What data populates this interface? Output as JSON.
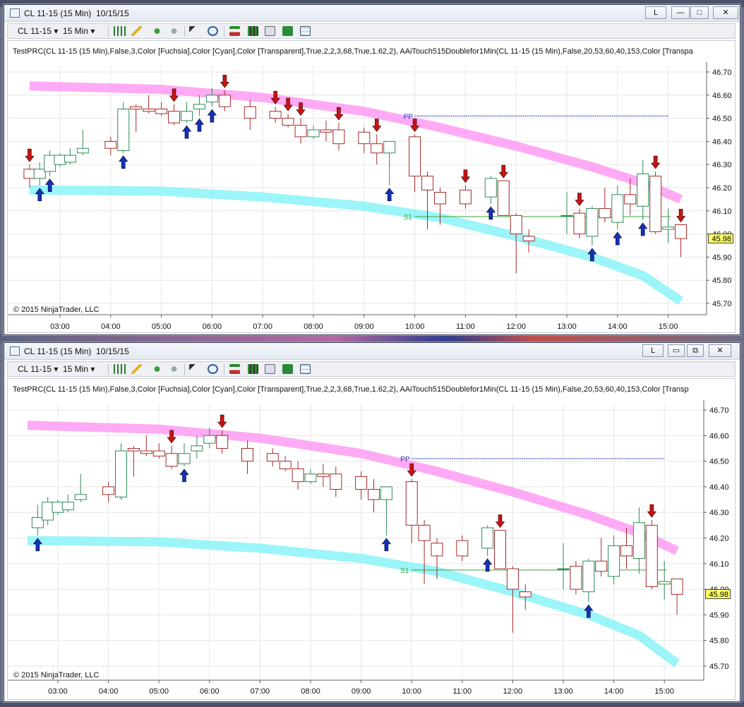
{
  "windows": [
    {
      "title": "CL 11-15 (15 Min)  10/15/15",
      "controls": {
        "link": "L",
        "minimize": "—",
        "maximize": "□",
        "close": "✕"
      },
      "toolbar": {
        "instrument": "CL 11-15",
        "interval": "15 Min"
      },
      "indicator_label": "TestPRC(CL 11-15 (15 Min),False,3,Color [Fuchsia],Color [Cyan],Color [Transparent],True,2,2,3,68,True,1.62,2), AAiTouch515Doublefor1Min(CL 11-15 (15 Min),False,20,53,60,40,153,Color [Transpa",
      "copyright": "© 2015 NinjaTrader, LLC",
      "last_price": "45.98",
      "pivot_labels": {
        "pp": "PP",
        "s1": "S1"
      }
    },
    {
      "title": "CL 11-15 (15 Min)  10/15/15",
      "controls": {
        "link": "L",
        "minimize": "▭",
        "maximize": "⧉",
        "close": "✕"
      },
      "toolbar": {
        "instrument": "CL 11-15",
        "interval": "15 Min"
      },
      "indicator_label": "TestPRC(CL 11-15 (15 Min),False,3,Color [Fuchsia],Color [Cyan],Color [Transparent],True,2,2,3,68,True,1.62,2), AAiTouch515Doublefor1Min(CL 11-15 (15 Min),False,20,53,60,40,153,Color [Transp",
      "copyright": "© 2015 NinjaTrader, LLC",
      "last_price": "45.98",
      "pivot_labels": {
        "pp": "PP",
        "s1": "S1"
      }
    }
  ],
  "chart_data": [
    {
      "type": "candlestick",
      "instrument": "CL 11-15",
      "interval": "15 Min",
      "x_ticks": [
        "03:00",
        "04:00",
        "05:00",
        "06:00",
        "07:00",
        "08:00",
        "09:00",
        "10:00",
        "11:00",
        "12:00",
        "13:00",
        "14:00",
        "15:00"
      ],
      "y_ticks": [
        "46.70",
        "46.60",
        "46.50",
        "46.40",
        "46.30",
        "46.20",
        "46.10",
        "46.00",
        "45.90",
        "45.80",
        "45.70"
      ],
      "ylim": [
        45.66,
        46.75
      ],
      "pivot_pp": 46.51,
      "pivot_s1": 46.075,
      "last_price": 45.98,
      "colors": {
        "up": "#2e8b57",
        "down": "#a52a2a",
        "upper_band": "#ff9bf2",
        "lower_band": "#8af3f8",
        "pivot_pp": "#1f2fb4",
        "pivot_s1": "#3aa53a",
        "sell_arrow": "#c41414",
        "buy_arrow": "#1432b4"
      },
      "candles": [
        {
          "t": 2.4,
          "o": 46.28,
          "h": 46.3,
          "l": 46.2,
          "c": 46.24
        },
        {
          "t": 2.6,
          "o": 46.24,
          "h": 46.31,
          "l": 46.21,
          "c": 46.28
        },
        {
          "t": 2.8,
          "o": 46.27,
          "h": 46.36,
          "l": 46.25,
          "c": 46.34
        },
        {
          "t": 3.0,
          "o": 46.3,
          "h": 46.35,
          "l": 46.29,
          "c": 46.34
        },
        {
          "t": 3.2,
          "o": 46.31,
          "h": 46.37,
          "l": 46.3,
          "c": 46.34
        },
        {
          "t": 3.45,
          "o": 46.35,
          "h": 46.45,
          "l": 46.34,
          "c": 46.37
        },
        {
          "t": 4.0,
          "o": 46.4,
          "h": 46.42,
          "l": 46.34,
          "c": 46.37
        },
        {
          "t": 4.25,
          "o": 46.36,
          "h": 46.57,
          "l": 46.35,
          "c": 46.54
        },
        {
          "t": 4.5,
          "o": 46.55,
          "h": 46.56,
          "l": 46.44,
          "c": 46.54
        },
        {
          "t": 4.75,
          "o": 46.54,
          "h": 46.6,
          "l": 46.52,
          "c": 46.53
        },
        {
          "t": 5.0,
          "o": 46.54,
          "h": 46.57,
          "l": 46.51,
          "c": 46.52
        },
        {
          "t": 5.25,
          "o": 46.53,
          "h": 46.56,
          "l": 46.47,
          "c": 46.48
        },
        {
          "t": 5.5,
          "o": 46.49,
          "h": 46.57,
          "l": 46.48,
          "c": 46.53
        },
        {
          "t": 5.75,
          "o": 46.54,
          "h": 46.6,
          "l": 46.51,
          "c": 46.56
        },
        {
          "t": 6.0,
          "o": 46.57,
          "h": 46.63,
          "l": 46.55,
          "c": 46.6
        },
        {
          "t": 6.25,
          "o": 46.6,
          "h": 46.62,
          "l": 46.53,
          "c": 46.55
        },
        {
          "t": 6.75,
          "o": 46.55,
          "h": 46.58,
          "l": 46.45,
          "c": 46.5
        },
        {
          "t": 7.25,
          "o": 46.53,
          "h": 46.55,
          "l": 46.48,
          "c": 46.5
        },
        {
          "t": 7.5,
          "o": 46.5,
          "h": 46.52,
          "l": 46.46,
          "c": 46.47
        },
        {
          "t": 7.75,
          "o": 46.47,
          "h": 46.5,
          "l": 46.39,
          "c": 46.42
        },
        {
          "t": 8.0,
          "o": 46.42,
          "h": 46.47,
          "l": 46.41,
          "c": 46.45
        },
        {
          "t": 8.25,
          "o": 46.45,
          "h": 46.49,
          "l": 46.4,
          "c": 46.44
        },
        {
          "t": 8.5,
          "o": 46.45,
          "h": 46.48,
          "l": 46.36,
          "c": 46.39
        },
        {
          "t": 9.0,
          "o": 46.44,
          "h": 46.46,
          "l": 46.35,
          "c": 46.39
        },
        {
          "t": 9.25,
          "o": 46.39,
          "h": 46.43,
          "l": 46.3,
          "c": 46.35
        },
        {
          "t": 9.5,
          "o": 46.35,
          "h": 46.4,
          "l": 46.21,
          "c": 46.4
        },
        {
          "t": 10.0,
          "o": 46.42,
          "h": 46.43,
          "l": 46.18,
          "c": 46.25
        },
        {
          "t": 10.25,
          "o": 46.25,
          "h": 46.27,
          "l": 46.02,
          "c": 46.19
        },
        {
          "t": 10.5,
          "o": 46.18,
          "h": 46.2,
          "l": 46.04,
          "c": 46.13
        },
        {
          "t": 11.0,
          "o": 46.19,
          "h": 46.21,
          "l": 46.11,
          "c": 46.13
        },
        {
          "t": 11.5,
          "o": 46.16,
          "h": 46.25,
          "l": 46.13,
          "c": 46.24
        },
        {
          "t": 11.75,
          "o": 46.23,
          "h": 46.23,
          "l": 46.08,
          "c": 46.08
        },
        {
          "t": 12.0,
          "o": 46.08,
          "h": 46.09,
          "l": 45.83,
          "c": 46.0
        },
        {
          "t": 12.25,
          "o": 45.99,
          "h": 46.02,
          "l": 45.92,
          "c": 45.97
        },
        {
          "t": 13.0,
          "o": 46.08,
          "h": 46.18,
          "l": 46.0,
          "c": 46.08
        },
        {
          "t": 13.25,
          "o": 46.09,
          "h": 46.11,
          "l": 45.98,
          "c": 46.0
        },
        {
          "t": 13.5,
          "o": 45.99,
          "h": 46.12,
          "l": 45.95,
          "c": 46.11
        },
        {
          "t": 13.75,
          "o": 46.11,
          "h": 46.2,
          "l": 46.05,
          "c": 46.07
        },
        {
          "t": 14.0,
          "o": 46.05,
          "h": 46.21,
          "l": 46.02,
          "c": 46.17
        },
        {
          "t": 14.25,
          "o": 46.17,
          "h": 46.24,
          "l": 46.08,
          "c": 46.13
        },
        {
          "t": 14.5,
          "o": 46.12,
          "h": 46.32,
          "l": 46.06,
          "c": 46.26
        },
        {
          "t": 14.75,
          "o": 46.25,
          "h": 46.27,
          "l": 46.0,
          "c": 46.01
        },
        {
          "t": 15.0,
          "o": 46.02,
          "h": 46.11,
          "l": 45.96,
          "c": 46.03
        },
        {
          "t": 15.25,
          "o": 46.04,
          "h": 46.04,
          "l": 45.9,
          "c": 45.98
        }
      ],
      "upper_band": [
        [
          2.4,
          46.64
        ],
        [
          5.0,
          46.625
        ],
        [
          7.0,
          46.59
        ],
        [
          9.0,
          46.53
        ],
        [
          10.5,
          46.46
        ],
        [
          12.0,
          46.38
        ],
        [
          13.5,
          46.29
        ],
        [
          14.5,
          46.22
        ],
        [
          15.25,
          46.15
        ]
      ],
      "lower_band": [
        [
          2.4,
          46.19
        ],
        [
          5.0,
          46.185
        ],
        [
          7.0,
          46.16
        ],
        [
          9.0,
          46.12
        ],
        [
          10.5,
          46.07
        ],
        [
          12.0,
          45.99
        ],
        [
          13.5,
          45.9
        ],
        [
          14.5,
          45.82
        ],
        [
          15.25,
          45.71
        ]
      ],
      "sell_signals": [
        2.4,
        5.25,
        6.25,
        7.25,
        7.5,
        7.75,
        8.5,
        9.25,
        10.0,
        11.0,
        11.75,
        13.25,
        14.75,
        15.25
      ],
      "buy_signals": [
        2.6,
        2.8,
        4.25,
        5.5,
        5.75,
        6.0,
        9.5,
        11.5,
        13.5,
        14.0,
        14.5
      ]
    },
    {
      "type": "candlestick",
      "instrument": "CL 11-15",
      "interval": "15 Min",
      "x_ticks": [
        "03:00",
        "04:00",
        "05:00",
        "06:00",
        "07:00",
        "08:00",
        "09:00",
        "10:00",
        "11:00",
        "12:00",
        "13:00",
        "14:00",
        "15:00"
      ],
      "y_ticks": [
        "46.70",
        "46.60",
        "46.50",
        "46.40",
        "46.30",
        "46.20",
        "46.10",
        "46.00",
        "45.90",
        "45.80",
        "45.70"
      ],
      "ylim": [
        45.66,
        46.75
      ],
      "pivot_pp": 46.51,
      "pivot_s1": 46.075,
      "last_price": 45.98,
      "colors": {
        "up": "#2e8b57",
        "down": "#a52a2a",
        "upper_band": "#ff9bf2",
        "lower_band": "#8af3f8",
        "pivot_pp": "#1f2fb4",
        "pivot_s1": "#3aa53a",
        "sell_arrow": "#c41414",
        "buy_arrow": "#1432b4"
      },
      "candles": [
        {
          "t": 2.6,
          "o": 46.24,
          "h": 46.33,
          "l": 46.21,
          "c": 46.28
        },
        {
          "t": 2.8,
          "o": 46.27,
          "h": 46.36,
          "l": 46.25,
          "c": 46.34
        },
        {
          "t": 3.0,
          "o": 46.3,
          "h": 46.35,
          "l": 46.29,
          "c": 46.34
        },
        {
          "t": 3.2,
          "o": 46.31,
          "h": 46.37,
          "l": 46.3,
          "c": 46.34
        },
        {
          "t": 3.45,
          "o": 46.35,
          "h": 46.45,
          "l": 46.34,
          "c": 46.37
        },
        {
          "t": 4.0,
          "o": 46.4,
          "h": 46.42,
          "l": 46.34,
          "c": 46.37
        },
        {
          "t": 4.25,
          "o": 46.36,
          "h": 46.57,
          "l": 46.35,
          "c": 46.54
        },
        {
          "t": 4.5,
          "o": 46.55,
          "h": 46.56,
          "l": 46.44,
          "c": 46.54
        },
        {
          "t": 4.75,
          "o": 46.54,
          "h": 46.6,
          "l": 46.52,
          "c": 46.53
        },
        {
          "t": 5.0,
          "o": 46.54,
          "h": 46.57,
          "l": 46.51,
          "c": 46.52
        },
        {
          "t": 5.25,
          "o": 46.53,
          "h": 46.56,
          "l": 46.47,
          "c": 46.48
        },
        {
          "t": 5.5,
          "o": 46.49,
          "h": 46.57,
          "l": 46.48,
          "c": 46.53
        },
        {
          "t": 5.75,
          "o": 46.54,
          "h": 46.6,
          "l": 46.51,
          "c": 46.56
        },
        {
          "t": 6.0,
          "o": 46.57,
          "h": 46.63,
          "l": 46.55,
          "c": 46.6
        },
        {
          "t": 6.25,
          "o": 46.6,
          "h": 46.62,
          "l": 46.53,
          "c": 46.55
        },
        {
          "t": 6.75,
          "o": 46.55,
          "h": 46.58,
          "l": 46.45,
          "c": 46.5
        },
        {
          "t": 7.25,
          "o": 46.53,
          "h": 46.55,
          "l": 46.48,
          "c": 46.5
        },
        {
          "t": 7.5,
          "o": 46.5,
          "h": 46.52,
          "l": 46.46,
          "c": 46.47
        },
        {
          "t": 7.75,
          "o": 46.47,
          "h": 46.5,
          "l": 46.39,
          "c": 46.42
        },
        {
          "t": 8.0,
          "o": 46.42,
          "h": 46.47,
          "l": 46.41,
          "c": 46.45
        },
        {
          "t": 8.25,
          "o": 46.45,
          "h": 46.49,
          "l": 46.4,
          "c": 46.44
        },
        {
          "t": 8.5,
          "o": 46.45,
          "h": 46.48,
          "l": 46.36,
          "c": 46.39
        },
        {
          "t": 9.0,
          "o": 46.44,
          "h": 46.46,
          "l": 46.35,
          "c": 46.39
        },
        {
          "t": 9.25,
          "o": 46.39,
          "h": 46.43,
          "l": 46.3,
          "c": 46.35
        },
        {
          "t": 9.5,
          "o": 46.35,
          "h": 46.4,
          "l": 46.21,
          "c": 46.4
        },
        {
          "t": 10.0,
          "o": 46.42,
          "h": 46.43,
          "l": 46.18,
          "c": 46.25
        },
        {
          "t": 10.25,
          "o": 46.25,
          "h": 46.27,
          "l": 46.02,
          "c": 46.19
        },
        {
          "t": 10.5,
          "o": 46.18,
          "h": 46.2,
          "l": 46.04,
          "c": 46.13
        },
        {
          "t": 11.0,
          "o": 46.19,
          "h": 46.21,
          "l": 46.11,
          "c": 46.13
        },
        {
          "t": 11.5,
          "o": 46.16,
          "h": 46.25,
          "l": 46.13,
          "c": 46.24
        },
        {
          "t": 11.75,
          "o": 46.23,
          "h": 46.23,
          "l": 46.08,
          "c": 46.08
        },
        {
          "t": 12.0,
          "o": 46.08,
          "h": 46.09,
          "l": 45.83,
          "c": 46.0
        },
        {
          "t": 12.25,
          "o": 45.99,
          "h": 46.02,
          "l": 45.92,
          "c": 45.97
        },
        {
          "t": 13.0,
          "o": 46.08,
          "h": 46.18,
          "l": 46.0,
          "c": 46.08
        },
        {
          "t": 13.25,
          "o": 46.09,
          "h": 46.11,
          "l": 45.98,
          "c": 46.0
        },
        {
          "t": 13.5,
          "o": 45.99,
          "h": 46.12,
          "l": 45.95,
          "c": 46.11
        },
        {
          "t": 13.75,
          "o": 46.11,
          "h": 46.2,
          "l": 46.05,
          "c": 46.07
        },
        {
          "t": 14.0,
          "o": 46.05,
          "h": 46.21,
          "l": 46.02,
          "c": 46.17
        },
        {
          "t": 14.25,
          "o": 46.17,
          "h": 46.24,
          "l": 46.08,
          "c": 46.13
        },
        {
          "t": 14.5,
          "o": 46.12,
          "h": 46.32,
          "l": 46.06,
          "c": 46.26
        },
        {
          "t": 14.75,
          "o": 46.25,
          "h": 46.27,
          "l": 46.0,
          "c": 46.01
        },
        {
          "t": 15.0,
          "o": 46.02,
          "h": 46.11,
          "l": 45.96,
          "c": 46.03
        },
        {
          "t": 15.25,
          "o": 46.04,
          "h": 46.04,
          "l": 45.9,
          "c": 45.98
        }
      ],
      "upper_band": [
        [
          2.4,
          46.64
        ],
        [
          5.0,
          46.625
        ],
        [
          7.0,
          46.59
        ],
        [
          9.0,
          46.53
        ],
        [
          10.5,
          46.46
        ],
        [
          12.0,
          46.38
        ],
        [
          13.5,
          46.29
        ],
        [
          14.5,
          46.22
        ],
        [
          15.25,
          46.15
        ]
      ],
      "lower_band": [
        [
          2.4,
          46.19
        ],
        [
          5.0,
          46.185
        ],
        [
          7.0,
          46.16
        ],
        [
          9.0,
          46.12
        ],
        [
          10.5,
          46.07
        ],
        [
          12.0,
          45.99
        ],
        [
          13.5,
          45.9
        ],
        [
          14.5,
          45.82
        ],
        [
          15.25,
          45.71
        ]
      ],
      "sell_signals": [
        5.25,
        6.25,
        10.0,
        11.75,
        14.75
      ],
      "buy_signals": [
        2.6,
        5.5,
        9.5,
        11.5,
        13.5
      ]
    }
  ]
}
